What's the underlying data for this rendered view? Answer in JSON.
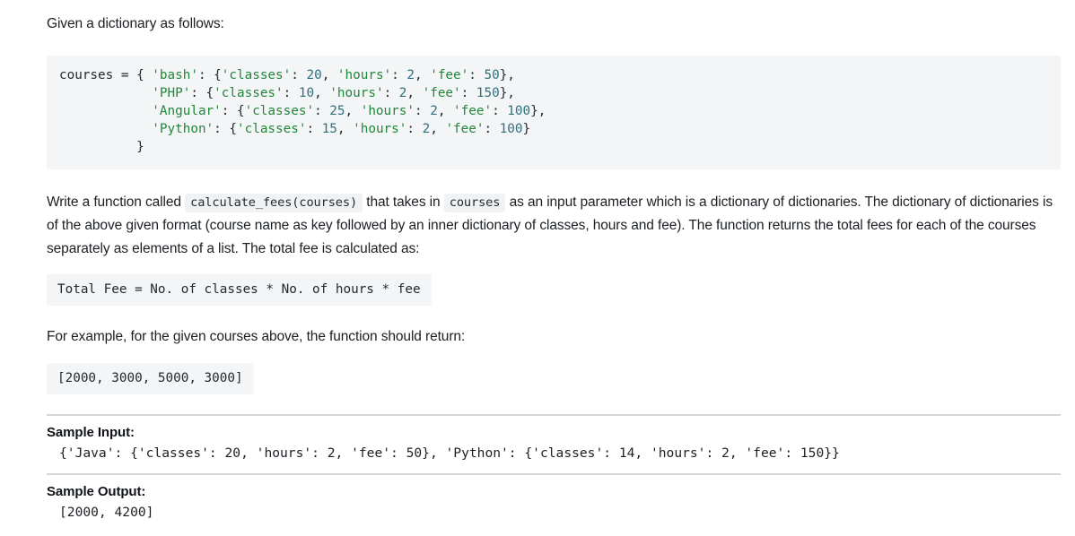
{
  "intro": "Given a dictionary as follows:",
  "dictionary_code": {
    "lines": [
      [
        {
          "t": "courses = { ",
          "c": "punct"
        },
        {
          "t": "'bash'",
          "c": "str"
        },
        {
          "t": ": {",
          "c": "punct"
        },
        {
          "t": "'classes'",
          "c": "str"
        },
        {
          "t": ": ",
          "c": "punct"
        },
        {
          "t": "20",
          "c": "num"
        },
        {
          "t": ", ",
          "c": "punct"
        },
        {
          "t": "'hours'",
          "c": "str"
        },
        {
          "t": ": ",
          "c": "punct"
        },
        {
          "t": "2",
          "c": "num"
        },
        {
          "t": ", ",
          "c": "punct"
        },
        {
          "t": "'fee'",
          "c": "str"
        },
        {
          "t": ": ",
          "c": "punct"
        },
        {
          "t": "50",
          "c": "num"
        },
        {
          "t": "},",
          "c": "punct"
        }
      ],
      [
        {
          "t": "            ",
          "c": "punct"
        },
        {
          "t": "'PHP'",
          "c": "str"
        },
        {
          "t": ": {",
          "c": "punct"
        },
        {
          "t": "'classes'",
          "c": "str"
        },
        {
          "t": ": ",
          "c": "punct"
        },
        {
          "t": "10",
          "c": "num"
        },
        {
          "t": ", ",
          "c": "punct"
        },
        {
          "t": "'hours'",
          "c": "str"
        },
        {
          "t": ": ",
          "c": "punct"
        },
        {
          "t": "2",
          "c": "num"
        },
        {
          "t": ", ",
          "c": "punct"
        },
        {
          "t": "'fee'",
          "c": "str"
        },
        {
          "t": ": ",
          "c": "punct"
        },
        {
          "t": "150",
          "c": "num"
        },
        {
          "t": "},",
          "c": "punct"
        }
      ],
      [
        {
          "t": "            ",
          "c": "punct"
        },
        {
          "t": "'Angular'",
          "c": "str"
        },
        {
          "t": ": {",
          "c": "punct"
        },
        {
          "t": "'classes'",
          "c": "str"
        },
        {
          "t": ": ",
          "c": "punct"
        },
        {
          "t": "25",
          "c": "num"
        },
        {
          "t": ", ",
          "c": "punct"
        },
        {
          "t": "'hours'",
          "c": "str"
        },
        {
          "t": ": ",
          "c": "punct"
        },
        {
          "t": "2",
          "c": "num"
        },
        {
          "t": ", ",
          "c": "punct"
        },
        {
          "t": "'fee'",
          "c": "str"
        },
        {
          "t": ": ",
          "c": "punct"
        },
        {
          "t": "100",
          "c": "num"
        },
        {
          "t": "},",
          "c": "punct"
        }
      ],
      [
        {
          "t": "            ",
          "c": "punct"
        },
        {
          "t": "'Python'",
          "c": "str"
        },
        {
          "t": ": {",
          "c": "punct"
        },
        {
          "t": "'classes'",
          "c": "str"
        },
        {
          "t": ": ",
          "c": "punct"
        },
        {
          "t": "15",
          "c": "num"
        },
        {
          "t": ", ",
          "c": "punct"
        },
        {
          "t": "'hours'",
          "c": "str"
        },
        {
          "t": ": ",
          "c": "punct"
        },
        {
          "t": "2",
          "c": "num"
        },
        {
          "t": ", ",
          "c": "punct"
        },
        {
          "t": "'fee'",
          "c": "str"
        },
        {
          "t": ": ",
          "c": "punct"
        },
        {
          "t": "100",
          "c": "num"
        },
        {
          "t": "}",
          "c": "punct"
        }
      ],
      [
        {
          "t": "          }",
          "c": "punct"
        }
      ]
    ]
  },
  "description": {
    "part1": "Write a function called ",
    "code1": "calculate_fees(courses)",
    "part2": " that takes in ",
    "code2": "courses",
    "part3": " as an input parameter which is a dictionary of dictionaries. The dictionary of dictionaries is of the above given format (course name as key followed by an inner dictionary of classes, hours and fee). The function returns the total fees for each of the courses separately as elements of a list. The total fee is calculated as:"
  },
  "formula": "Total Fee = No. of classes * No. of hours * fee",
  "example_intro": "For example, for the given courses above, the function should return:",
  "example_output": "[2000, 3000, 5000, 3000]",
  "sample_input": {
    "title": "Sample Input:",
    "value": "{'Java': {'classes': 20, 'hours': 2, 'fee': 50}, 'Python': {'classes': 14, 'hours': 2, 'fee': 150}}"
  },
  "sample_output": {
    "title": "Sample Output:",
    "value": "[2000, 4200]"
  },
  "colors": {
    "code_background": "#f4f5f6",
    "inline_code_background": "#f1f2f3",
    "string_token": "#22863a",
    "number_token": "#2f6f7e",
    "text": "#1b1f23",
    "divider": "#d6d6d6"
  }
}
